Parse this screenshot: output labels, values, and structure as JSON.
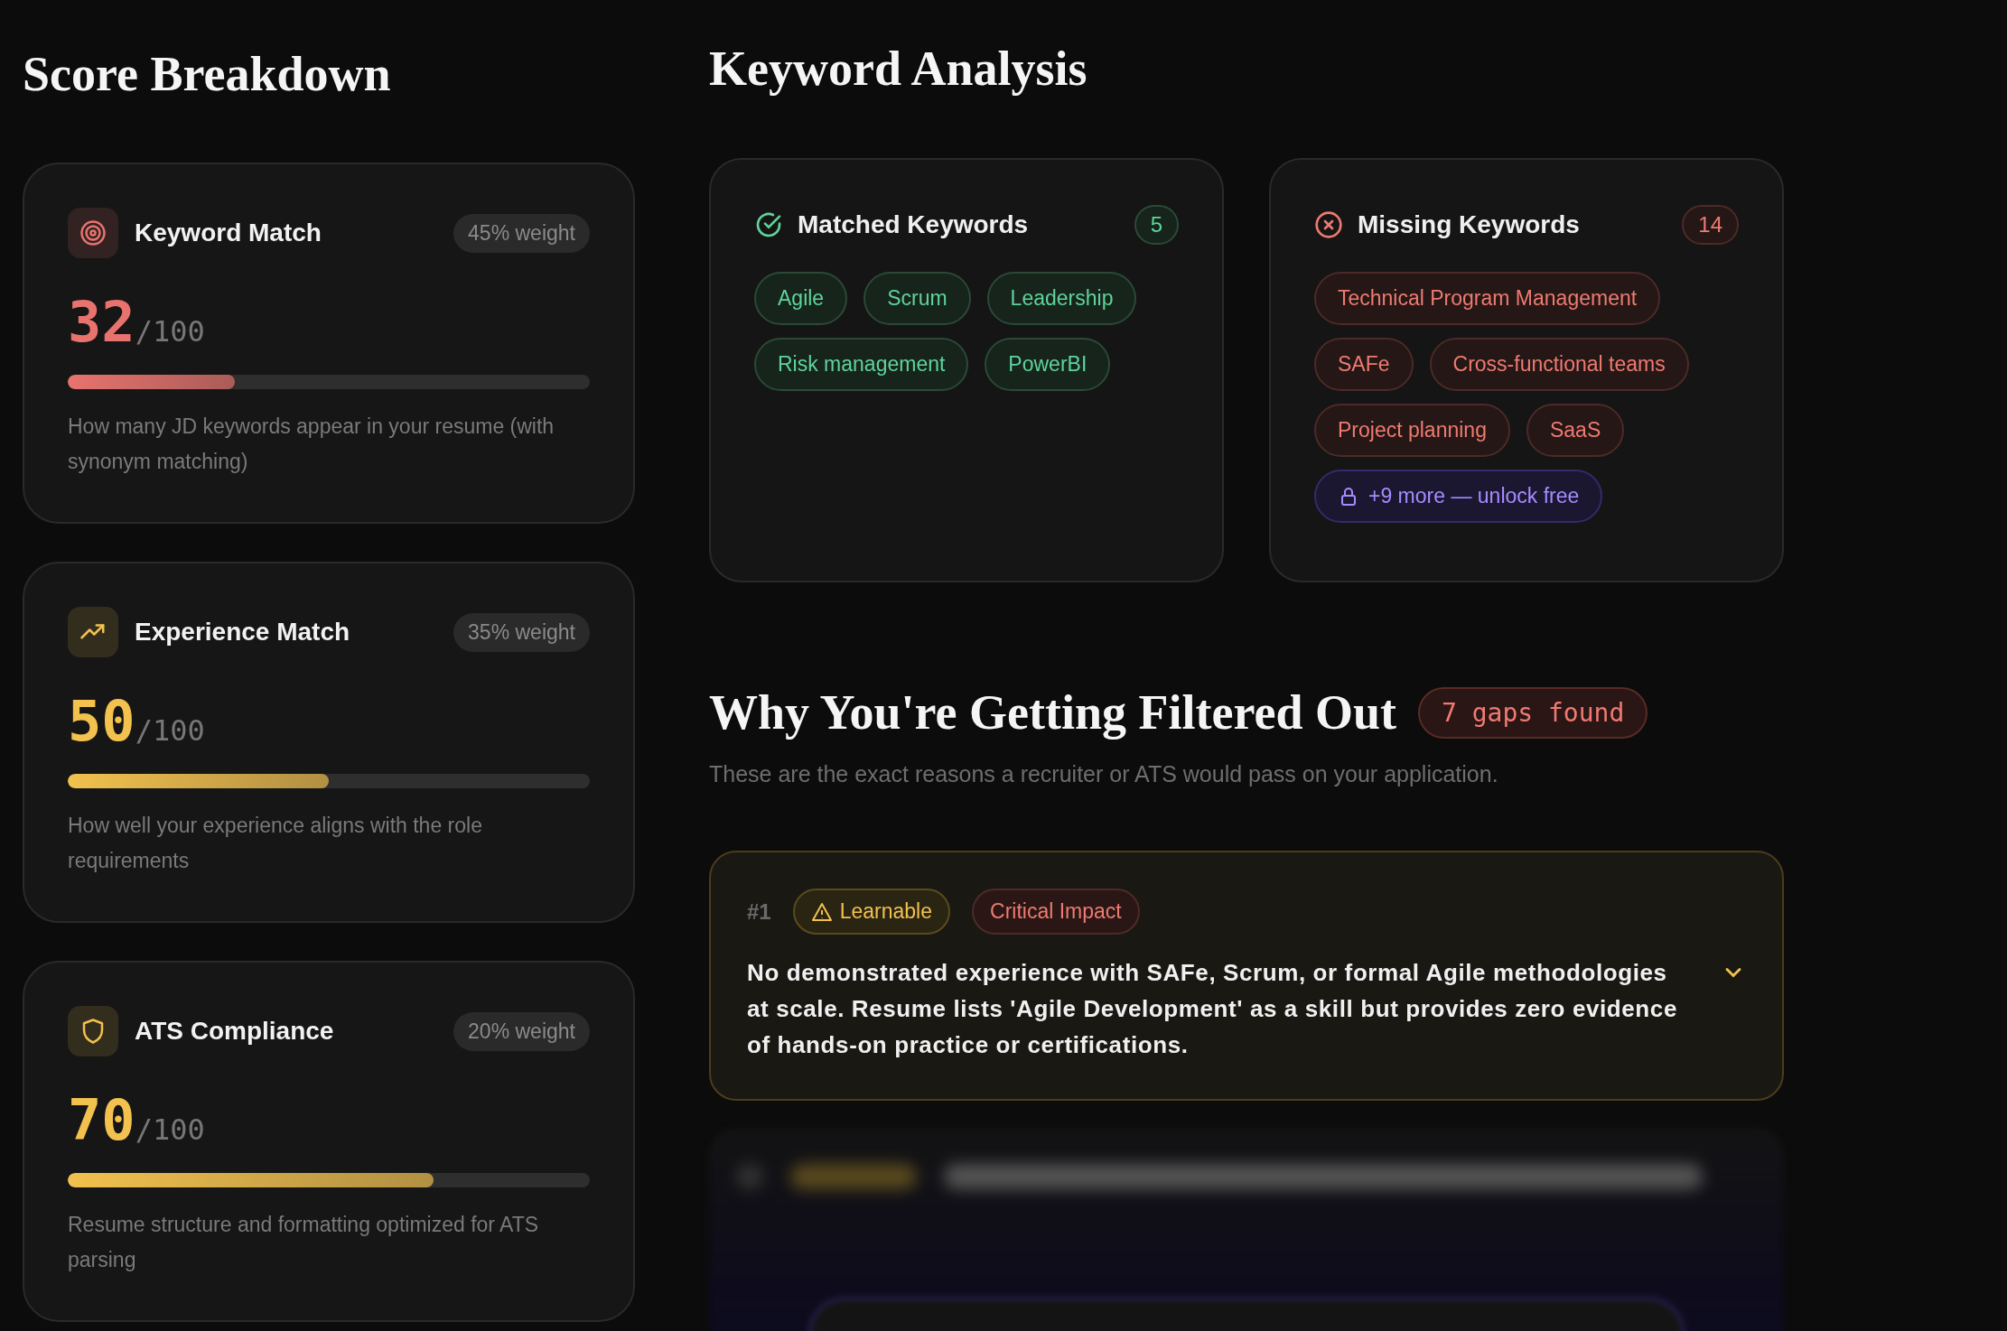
{
  "score_breakdown": {
    "title": "Score Breakdown",
    "cards": [
      {
        "kind": "target",
        "title": "Keyword Match",
        "weight": "45% weight",
        "score": "32",
        "max": "/100",
        "level": 0.32,
        "color": "#e8736e",
        "description": "How many JD keywords appear in your resume (with synonym matching)"
      },
      {
        "kind": "trend",
        "title": "Experience Match",
        "weight": "35% weight",
        "score": "50",
        "max": "/100",
        "level": 0.5,
        "color": "#f2c14e",
        "description": "How well your experience aligns with the role requirements"
      },
      {
        "kind": "shield",
        "title": "ATS Compliance",
        "weight": "20% weight",
        "score": "70",
        "max": "/100",
        "level": 0.7,
        "color": "#f2c14e",
        "description": "Resume structure and formatting optimized for ATS parsing"
      }
    ]
  },
  "keyword_analysis": {
    "title": "Keyword Analysis",
    "panels": [
      {
        "kind": "matched",
        "title": "Matched Keywords",
        "count": "5",
        "keywords": [
          "Agile",
          "Scrum",
          "Leadership",
          "Risk management",
          "PowerBI"
        ]
      },
      {
        "kind": "missing",
        "title": "Missing Keywords",
        "count": "14",
        "keywords": [
          "Technical Program Management",
          "SAFe",
          "Cross-functional teams",
          "Project planning",
          "SaaS"
        ],
        "unlock": "+9 more — unlock free"
      }
    ]
  },
  "filtered_out": {
    "title": "Why You're Getting Filtered Out",
    "badge": "7 gaps found",
    "subtitle": "These are the exact reasons a recruiter or ATS would pass on your application.",
    "gaps": [
      {
        "number": "#1",
        "tags": [
          {
            "kind": "learnable",
            "label": "Learnable"
          },
          {
            "kind": "critical",
            "label": "Critical Impact"
          }
        ],
        "text": "No demonstrated experience with SAFe, Scrum, or formal Agile methodologies at scale. Resume lists 'Agile Development' as a skill but provides zero evidence of hands-on practice or certifications."
      }
    ]
  }
}
